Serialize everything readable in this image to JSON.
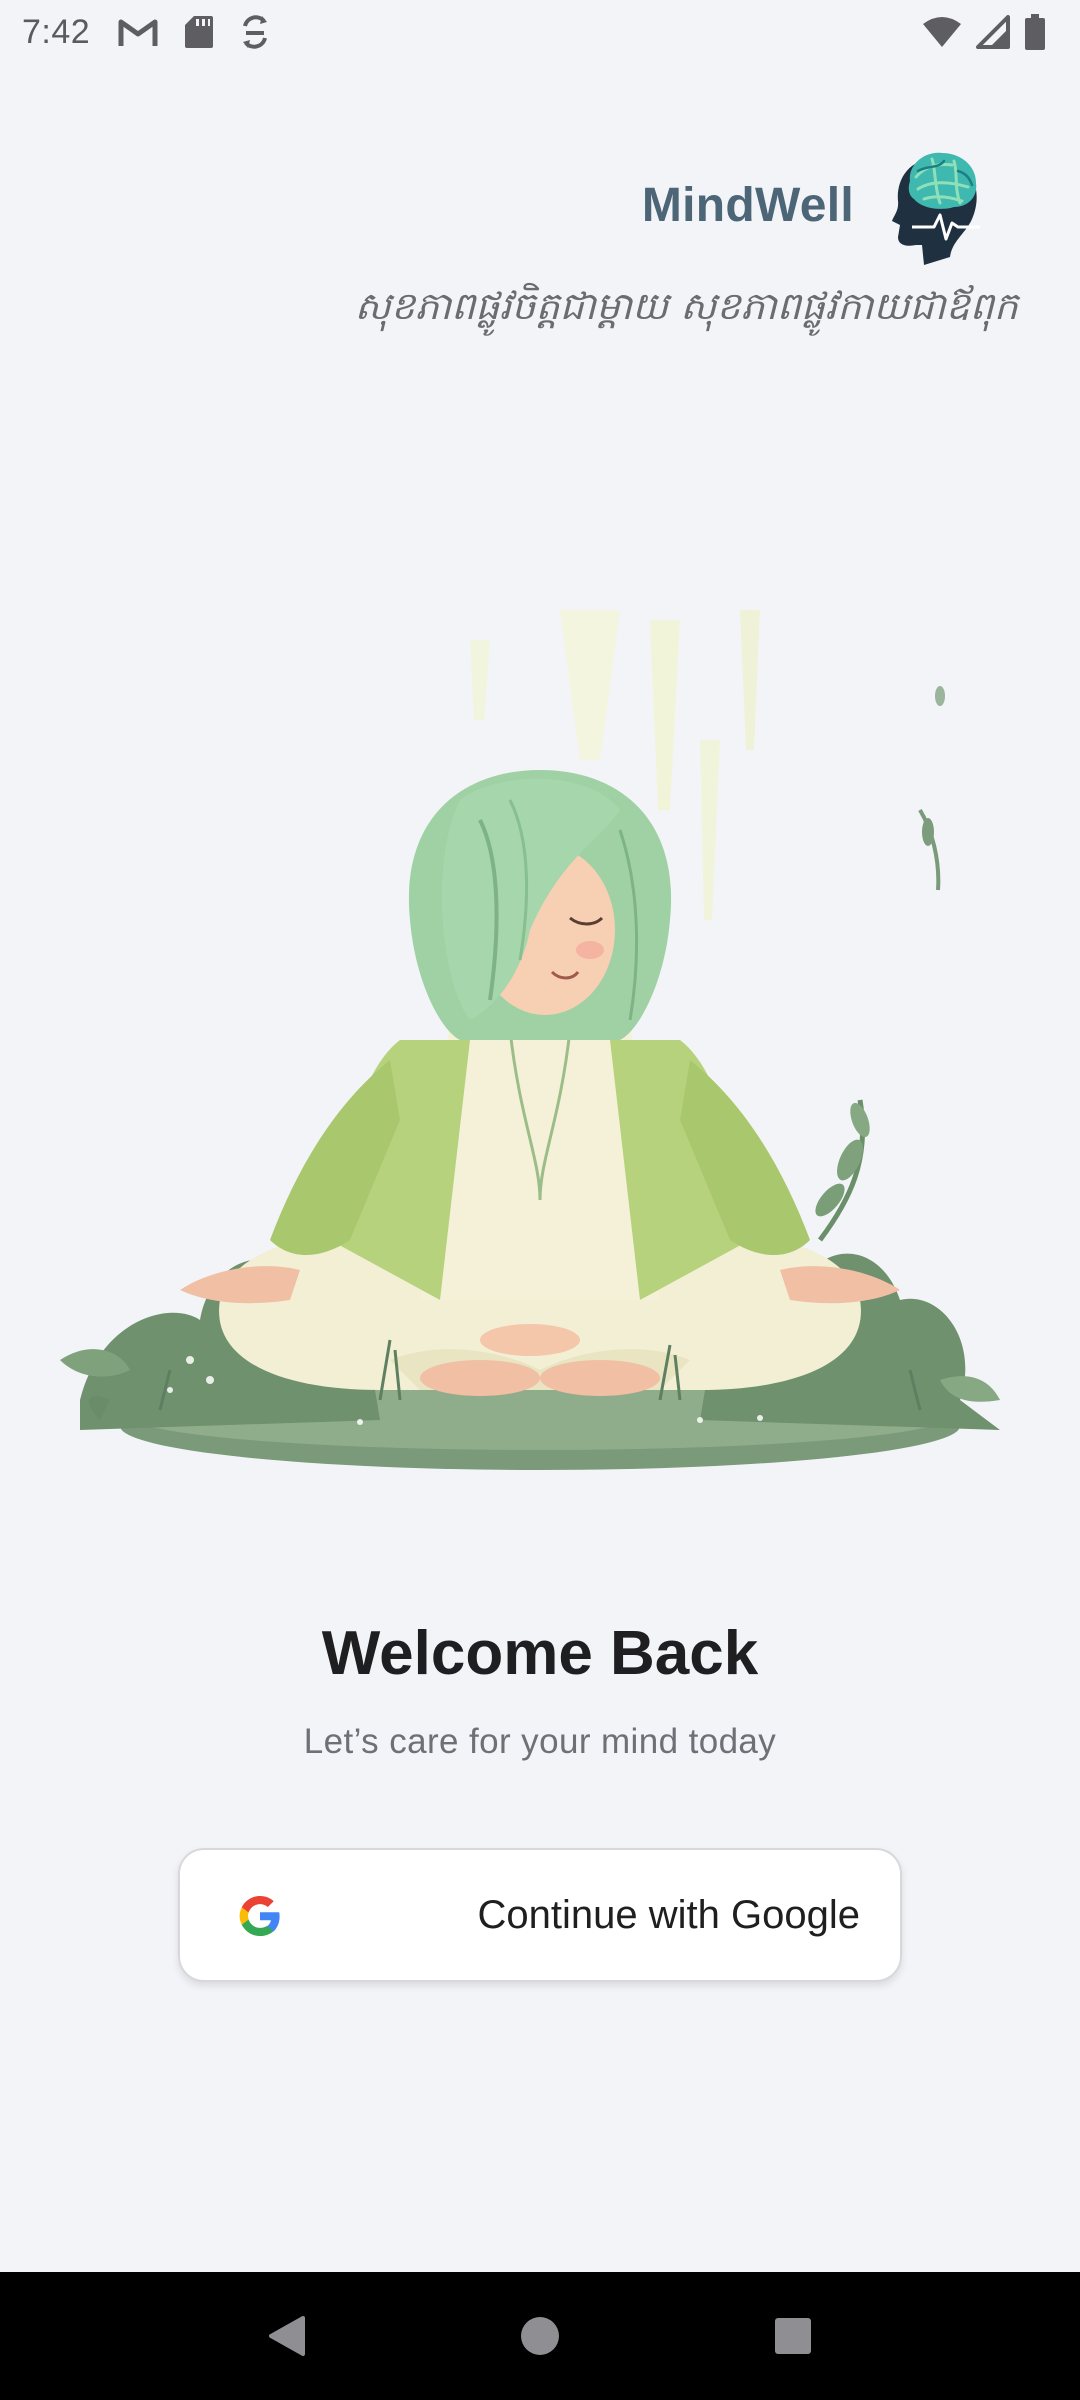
{
  "status_bar": {
    "time": "7:42",
    "left_icons": [
      "gmail-icon",
      "sd-card-icon",
      "sync-icon"
    ],
    "right_icons": [
      "wifi-icon",
      "cellular-signal-icon",
      "battery-icon"
    ]
  },
  "header": {
    "app_name": "MindWell",
    "logo_icon": "brain-head-logo-icon",
    "tagline": "សុខភាពផ្លូវចិត្តជាម្តាយ សុខភាពផ្លូវកាយជាឪពុក"
  },
  "illustration": {
    "icon": "meditating-woman-illustration"
  },
  "welcome": {
    "title": "Welcome Back",
    "subtitle": "Let’s care for your mind today"
  },
  "google_button": {
    "label": "Continue with Google",
    "icon": "google-g-icon"
  },
  "nav_bar": {
    "buttons": [
      "back-icon",
      "home-icon",
      "recents-icon"
    ]
  },
  "colors": {
    "background": "#f3f4f8",
    "brand_text": "#4c6678",
    "title_text": "#1f1f21",
    "subtitle_text": "#6f7077"
  }
}
